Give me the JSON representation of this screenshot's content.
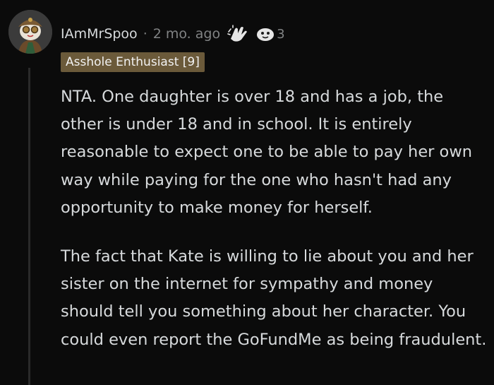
{
  "comment": {
    "author": "IAmMrSpoo",
    "separator": "·",
    "timestamp": "2 mo. ago",
    "awards": [
      {
        "icon": "clapping-hands-award-icon",
        "count": ""
      },
      {
        "icon": "wholesome-seal-award-icon",
        "count": "3"
      }
    ],
    "flair": "Asshole Enthusiast [9]",
    "paragraphs": [
      "NTA. One daughter is over 18 and has a job, the other is under 18 and in school. It is entirely reasonable to expect one to be able to pay her own way while paying for the one who hasn't had any opportunity to make money for herself.",
      "The fact that Kate is willing to lie about you and her sister on the internet for sympathy and money should tell you something about her character. You could even report the GoFundMe as being fraudulent."
    ]
  },
  "colors": {
    "background": "#0b0b0b",
    "text": "#d7dadc",
    "muted": "#818384",
    "flair_bg": "#6b5a3a",
    "thread_line": "#2a2a2a"
  }
}
